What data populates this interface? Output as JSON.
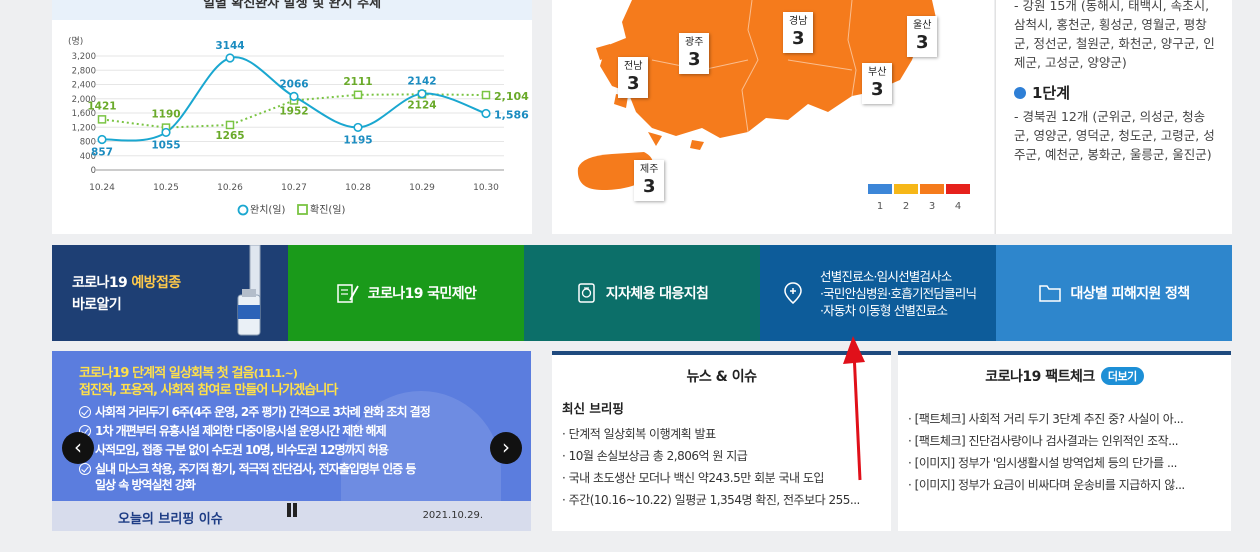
{
  "chart": {
    "title": "일별 확진환자 발생 및 완치 추세",
    "unit": "(명)",
    "y_ticks": [
      "3,200",
      "2,800",
      "2,400",
      "2,000",
      "1,600",
      "1,200",
      "800",
      "400",
      "0"
    ],
    "x_labels": [
      "10.24",
      "10.25",
      "10.26",
      "10.27",
      "10.28",
      "10.29",
      "10.30"
    ],
    "recovered": {
      "name": "완치(일)",
      "color": "#1aa7d0",
      "values": [
        857,
        1055,
        3144,
        2066,
        1195,
        2142,
        1586
      ],
      "labels": [
        "857",
        "1055",
        "3144",
        "2066",
        "1195",
        "2142",
        "1,586"
      ]
    },
    "confirmed": {
      "name": "확진(일)",
      "color": "#7ac443",
      "values": [
        1421,
        1190,
        1265,
        1952,
        2111,
        2124,
        2104
      ],
      "labels": [
        "1421",
        "1190",
        "1265",
        "1952",
        "2111",
        "2124",
        "2,104"
      ]
    }
  },
  "chart_data": {
    "type": "line",
    "title": "일별 확진환자 발생 및 완치 추세",
    "ylabel": "(명)",
    "x": [
      "10.24",
      "10.25",
      "10.26",
      "10.27",
      "10.28",
      "10.29",
      "10.30"
    ],
    "ylim": [
      0,
      3200
    ],
    "grid": true,
    "legend": "bottom",
    "series": [
      {
        "name": "완치(일)",
        "values": [
          857,
          1055,
          3144,
          2066,
          1195,
          2142,
          1586
        ]
      },
      {
        "name": "확진(일)",
        "values": [
          1421,
          1190,
          1265,
          1952,
          2111,
          2124,
          2104
        ]
      }
    ]
  },
  "map": {
    "fill_color": "#f57b1c",
    "regions": [
      {
        "name": "경남",
        "level": "3"
      },
      {
        "name": "울산",
        "level": "3"
      },
      {
        "name": "광주",
        "level": "3"
      },
      {
        "name": "전남",
        "level": "3"
      },
      {
        "name": "부산",
        "level": "3"
      },
      {
        "name": "제주",
        "level": "3"
      }
    ],
    "legend": [
      {
        "num": "1",
        "color": "#3c86d8"
      },
      {
        "num": "2",
        "color": "#f6b718"
      },
      {
        "num": "3",
        "color": "#f57b1c"
      },
      {
        "num": "4",
        "color": "#e6211c"
      }
    ]
  },
  "info": {
    "gangwon_text": "- 강원 15개 (동해시, 태백시, 속초시, 삼척시, 홍천군, 횡성군, 영월군, 평창군, 정선군, 철원군, 화천군, 양구군, 인제군, 고성군, 양양군)",
    "stage1_title": "1단계",
    "stage1_text": "- 경북권 12개 (군위군, 의성군, 청송군, 영양군, 영덕군, 청도군, 고령군, 성주군, 예천군, 봉화군, 울릉군, 울진군)"
  },
  "banners": {
    "vaccine_line1_a": "코로나19 ",
    "vaccine_line1_b": "예방접종",
    "vaccine_line2": "바로알기",
    "proposal": "코로나19 국민제안",
    "guideline": "지자체용 대응지침",
    "clinic_line1": "선별진료소·임시선별검사소",
    "clinic_line2": "·국민안심병원·호흡기전담클리닉",
    "clinic_line3": "·자동차 이동형 선별진료소",
    "support": "대상별 피해지원 정책"
  },
  "slider": {
    "headline1": "코로나19 단계적 일상회복 첫 걸음",
    "headline1_small": "(11.1.~)",
    "headline2": "접진적, 포용적, 사회적 참여로 만들어 나가겠습니다",
    "items": [
      "사회적 거리두기 6주(4주 운영, 2주 평가) 간격으로 3차례 완화 조치 결정",
      "1차 개편부터 유흥시설 제외한 다중이용시설 운영시간 제한 해제",
      "사적모임, 접종 구분 없이 수도권 10명, 비수도권 12명까지 허용",
      "실내 마스크 착용, 주기적 환기, 적극적 진단검사, 전자출입명부 인증 등",
      "일상 속 방역실천 강화"
    ],
    "footer_title": "오늘의 브리핑 이슈",
    "footer_date": "2021.10.29."
  },
  "news": {
    "title": "뉴스 & 이슈",
    "subhead": "최신 브리핑",
    "items": [
      "단계적 일상회복 이행계획 발표",
      "10월 손실보상금 총 2,806억 원 지급",
      "국내 초도생산 모더나 백신 약243.5만 회분 국내 도입",
      "주간(10.16~10.22) 일평균 1,354명 확진, 전주보다 255..."
    ]
  },
  "factcheck": {
    "title": "코로나19 팩트체크",
    "more": "더보기",
    "items": [
      "[팩트체크] 사회적 거리 두기 3단계 추진 중? 사실이 아...",
      "[팩트체크] 진단검사량이나 검사결과는 인위적인 조작...",
      "[이미지] 정부가 '임시생활시설 방역업체 등의 단가를 ...",
      "[이미지] 정부가 요금이 비싸다며 운송비를 지급하지 않..."
    ]
  }
}
